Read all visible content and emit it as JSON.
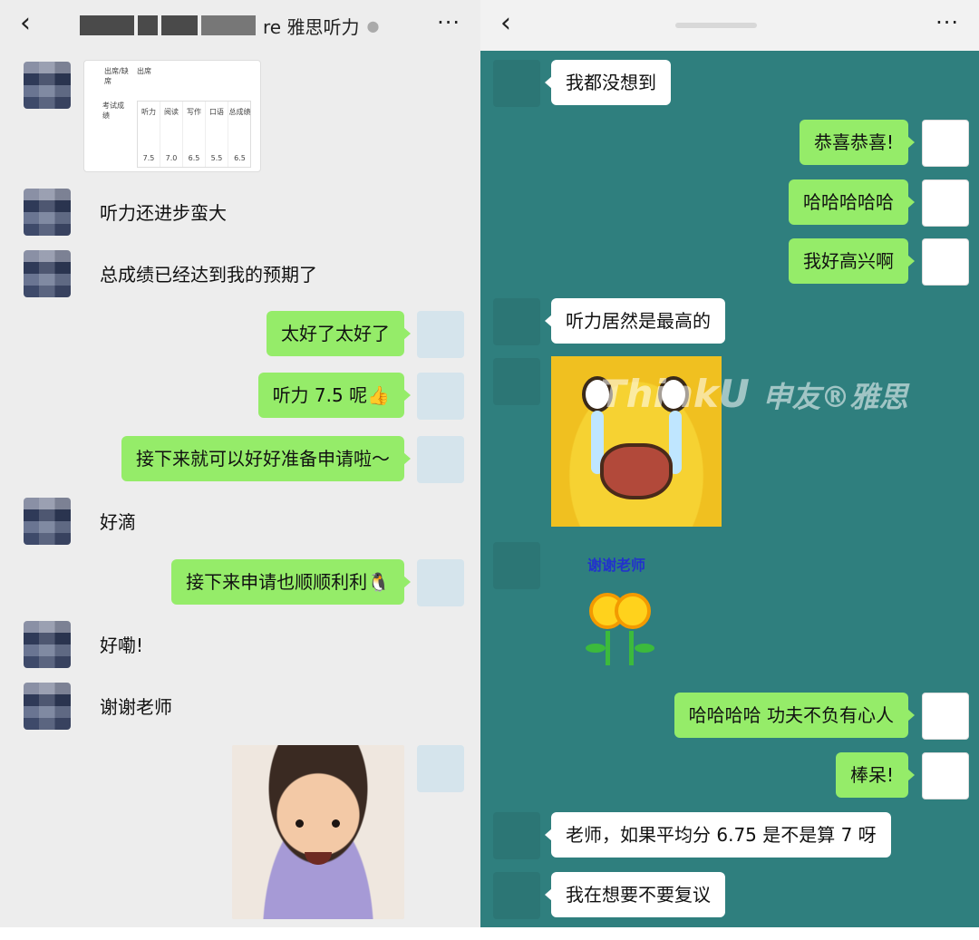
{
  "left_chat": {
    "header": {
      "back_icon": "chevron-left",
      "title_visible": "re 雅思听力",
      "ear_icon": "ear-icon",
      "more_label": "···"
    },
    "score_card": {
      "row1_label": "出席/缺席",
      "row1_value": "出席",
      "row2_label": "考试成绩",
      "columns": [
        {
          "label": "听力",
          "value": "7.5"
        },
        {
          "label": "阅读",
          "value": "7.0"
        },
        {
          "label": "写作",
          "value": "6.5"
        },
        {
          "label": "口语",
          "value": "5.5"
        },
        {
          "label": "总成绩",
          "value": "6.5"
        }
      ]
    },
    "messages": {
      "m1": "听力还进步蛮大",
      "m2": "总成绩已经达到我的预期了",
      "m3": "太好了太好了",
      "m4": "听力 7.5 呢👍",
      "m5": "接下来就可以好好准备申请啦～",
      "m6": "好滴",
      "m7": "接下来申请也顺顺利利🐧",
      "m8": "好嘞!",
      "m9": "谢谢老师"
    }
  },
  "right_chat": {
    "header": {
      "back_icon": "chevron-left",
      "more_label": "···"
    },
    "messages": {
      "r1": "我都没想到",
      "r2": "恭喜恭喜!",
      "r3": "哈哈哈哈哈",
      "r4": "我好高兴啊",
      "r5": "听力居然是最高的",
      "r6": "谢谢老师",
      "r7": "哈哈哈哈 功夫不负有心人",
      "r8": "棒呆!",
      "r9": "老师，如果平均分 6.75 是不是算 7 呀",
      "r10": "我在想要不要复议"
    },
    "watermark": {
      "latin": "ThinkU",
      "cn": "申友®雅思"
    }
  },
  "colors": {
    "left_bg": "#ededed",
    "right_bg": "#2f7f7e",
    "my_bubble": "#95ec69",
    "their_bubble": "#ffffff"
  }
}
